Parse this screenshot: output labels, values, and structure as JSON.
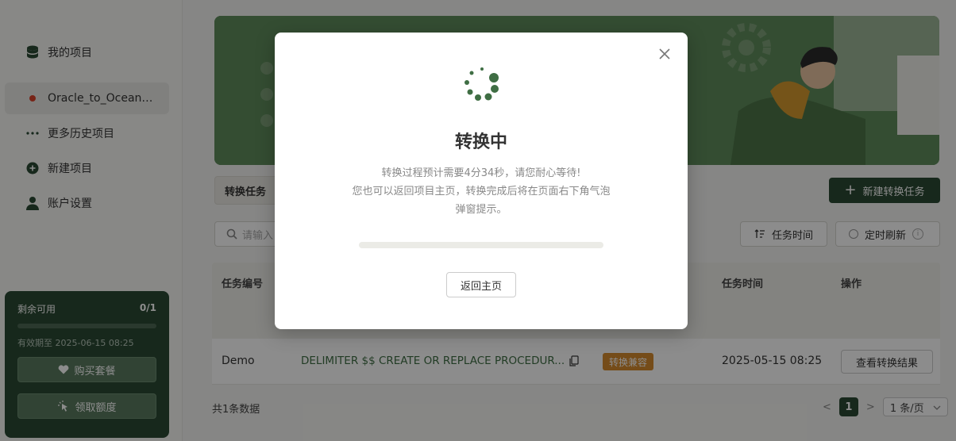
{
  "sidebar": {
    "items": [
      {
        "label": "我的项目",
        "icon": "database-icon"
      },
      {
        "label": "Oracle_to_OceanB...",
        "icon": "red-dot-icon",
        "active": true
      },
      {
        "label": "更多历史项目",
        "icon": "more-dots-icon"
      },
      {
        "label": "新建项目",
        "icon": "plus-circle-icon"
      },
      {
        "label": "账户设置",
        "icon": "user-icon"
      }
    ]
  },
  "quota": {
    "label": "剩余可用",
    "count": "0/1",
    "expire": "有效期至 2025-06-15 08:25",
    "buy_label": "购买套餐",
    "claim_label": "领取额度"
  },
  "toolbar": {
    "tab_label": "转换任务",
    "new_task_label": "新建转换任务",
    "search_placeholder": "请输入",
    "sort_label": "任务时间",
    "refresh_label": "定时刷新"
  },
  "table": {
    "headers": [
      "任务编号",
      "任务时间",
      "操作"
    ],
    "rows": [
      {
        "id": "Demo",
        "code": "DELIMITER $$ CREATE OR REPLACE PROCEDUR...",
        "badge": "转换兼容",
        "time": "2025-05-15 08:25",
        "action": "查看转换结果"
      }
    ]
  },
  "footer": {
    "total": "共1条数据",
    "prev": "<",
    "page": "1",
    "next": ">",
    "page_size": "1 条/页"
  },
  "modal": {
    "title": "转换中",
    "desc_line1": "转换过程预计需要4分34秒，请您耐心等待!",
    "desc_line2": "您也可以返回项目主页，转换完成后将在页面右下角气泡",
    "desc_line3": "弹窗提示。",
    "progress": 0,
    "back_label": "返回主页"
  },
  "colors": {
    "brand": "#2b4a34",
    "accent": "#5f8c5c",
    "badge": "#d68b2e"
  }
}
